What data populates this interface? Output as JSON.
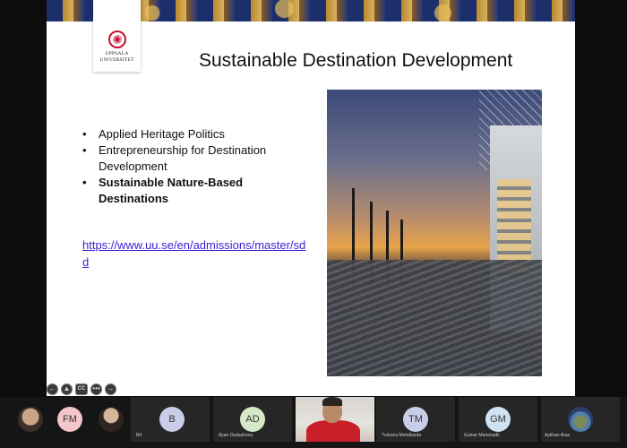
{
  "slide": {
    "title": "Sustainable Destination Development",
    "logo_line1": "UPPSALA",
    "logo_line2": "UNIVERSITET",
    "bullets": [
      {
        "text": "Applied Heritage Politics",
        "bold": false
      },
      {
        "text": "Entrepreneurship for Destination Development",
        "bold": false
      },
      {
        "text": "Sustainable Nature-Based Destinations",
        "bold": true
      }
    ],
    "link": "https://www.uu.se/en/admissions/master/sdd"
  },
  "controls": [
    {
      "name": "previous-icon",
      "glyph": "←"
    },
    {
      "name": "pointer-icon",
      "glyph": "▲"
    },
    {
      "name": "captions-icon",
      "glyph": "CC"
    },
    {
      "name": "more-icon",
      "glyph": "•••"
    },
    {
      "name": "next-icon",
      "glyph": "→"
    }
  ],
  "participants": [
    {
      "initials": "FM",
      "name": "",
      "color": "#f4c6c9"
    },
    {
      "initials": "B",
      "name": "Bif",
      "color": "#c9cde8"
    },
    {
      "initials": "AD",
      "name": "Ayan Dadashova",
      "color": "#d6e8c8"
    },
    {
      "initials": "TM",
      "name": "Turkana Mehdizada",
      "color": "#c9cde8"
    },
    {
      "initials": "GM",
      "name": "Gulnar Mammadli",
      "color": "#cfe2f2"
    },
    {
      "initials": "",
      "name": "Aykhan Aras",
      "color": ""
    }
  ]
}
